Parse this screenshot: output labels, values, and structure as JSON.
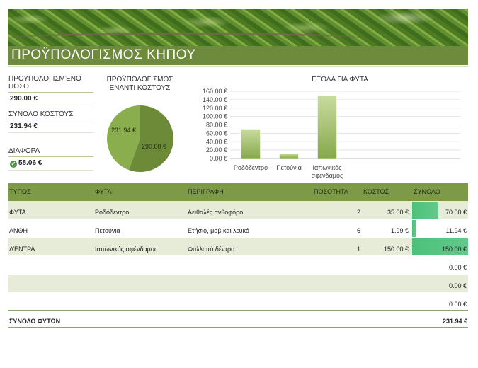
{
  "header": {
    "title": "ΠΡΟΫΠΟΛΟΓΙΣΜΟΣ ΚΗΠΟΥ"
  },
  "summary": {
    "budget_label": "ΠΡΟΥΠΟΛΟΓΙΣΜΈΝΟ ΠΟΣΟ",
    "budget_value": "290.00 €",
    "cost_label": "ΣΥΝΟΛΟ ΚΟΣΤΟΥΣ",
    "cost_value": "231.94 €",
    "diff_label": "ΔΙΑΦΟΡΑ",
    "diff_value": "58.06 €",
    "diff_icon": "check-circle-icon"
  },
  "pie": {
    "title_line1": "ΠΡΟΫΠΟΛΟΓΙΣΜΟΣ",
    "title_line2": "ΕΝΑΝΤΙ ΚΟΣΤΟΥΣ",
    "label_cost": "231.94 €",
    "label_budget": "290.00 €"
  },
  "bar": {
    "title": "ΕΞΟΔΑ ΓΙΑ ΦΥΤΑ",
    "ticks": [
      "0.00 €",
      "20.00 €",
      "40.00 €",
      "60.00 €",
      "80.00 €",
      "100.00 €",
      "120.00 €",
      "140.00 €",
      "160.00 €"
    ],
    "cat_labels": [
      [
        "Ροδόδεντρο"
      ],
      [
        "Πετούνια"
      ],
      [
        "Ιαπωνικός",
        "σφένδαμος"
      ]
    ]
  },
  "chart_data": [
    {
      "type": "pie",
      "title": "ΠΡΟΫΠΟΛΟΓΙΣΜΟΣ ΕΝΑΝΤΙ ΚΟΣΤΟΥΣ",
      "values": [
        231.94,
        290.0
      ],
      "colors": [
        "#8aad4e",
        "#6c8a38"
      ]
    },
    {
      "type": "bar",
      "title": "ΕΞΟΔΑ ΓΙΑ ΦΥΤΑ",
      "categories": [
        "Ροδόδεντρο",
        "Πετούνια",
        "Ιαπωνικός σφένδαμος"
      ],
      "values": [
        70.0,
        11.94,
        150.0
      ],
      "ylim": [
        0,
        160
      ],
      "grid": true,
      "color": "#a6c26a"
    }
  ],
  "table": {
    "headers": [
      "ΤΥΠΟΣ",
      "ΦΥΤΑ",
      "ΠΕΡΙΓΡΑΦΗ",
      "ΠΟΣΟΤΗΤΑ",
      "ΚΟΣΤΟΣ",
      "ΣΥΝΟΛΟ"
    ],
    "rows": [
      {
        "type": "ΦΥΤΑ",
        "plant": "Ροδόδεντρο",
        "desc": "Αειθαλές ανθοφόρο",
        "qty": "2",
        "cost": "35.00 €",
        "total": "70.00 €",
        "total_num": 70.0
      },
      {
        "type": "ΑΝΘΗ",
        "plant": "Πετούνια",
        "desc": "Ετήσιο, μοβ και λευκό",
        "qty": "6",
        "cost": "1.99 €",
        "total": "11.94 €",
        "total_num": 11.94
      },
      {
        "type": "ΔΈΝΤΡΑ",
        "plant": "Ιαπωνικός σφένδαμος",
        "desc": "Φυλλωτό δέντρο",
        "qty": "1",
        "cost": "150.00 €",
        "total": "150.00 €",
        "total_num": 150.0
      },
      {
        "type": "",
        "plant": "",
        "desc": "",
        "qty": "",
        "cost": "",
        "total": "0.00 €",
        "total_num": 0
      },
      {
        "type": "",
        "plant": "",
        "desc": "",
        "qty": "",
        "cost": "",
        "total": "0.00 €",
        "total_num": 0
      },
      {
        "type": "",
        "plant": "",
        "desc": "",
        "qty": "",
        "cost": "",
        "total": "0.00 €",
        "total_num": 0
      }
    ],
    "footer_label": "ΣΥΝΟΛΟ ΦΥΤΩΝ",
    "footer_total": "231.94 €"
  }
}
